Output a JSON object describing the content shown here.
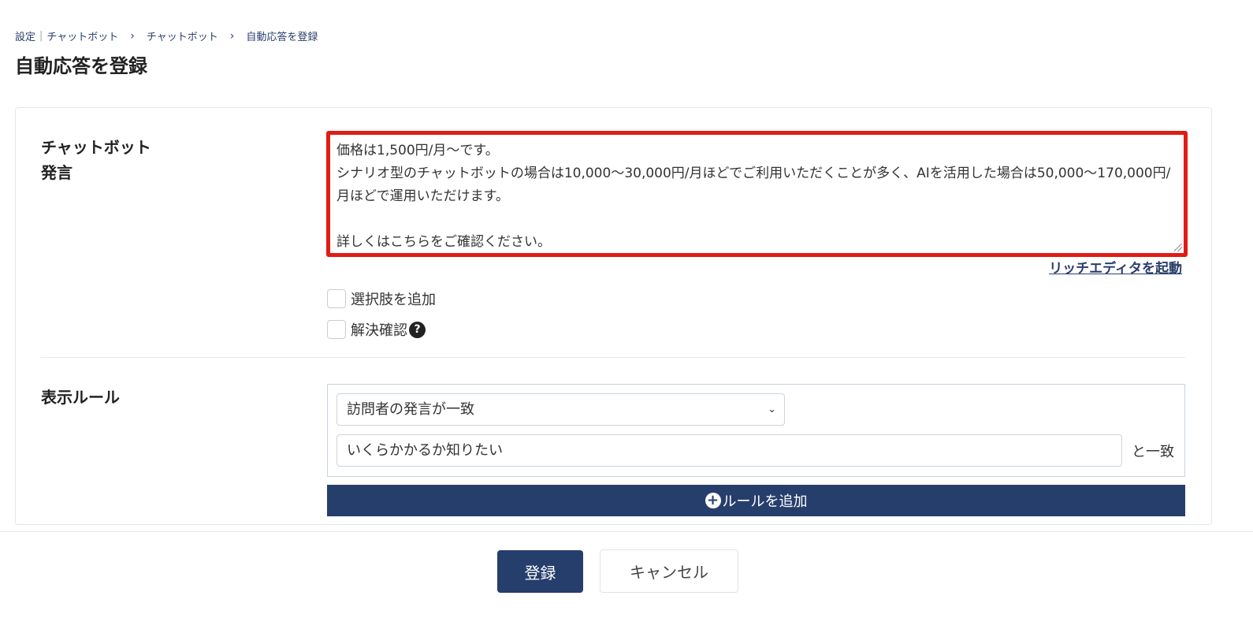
{
  "breadcrumb": {
    "root": "設定",
    "section": "チャットボット",
    "sub": "チャットボット",
    "current": "自動応答を登録"
  },
  "page_title": "自動応答を登録",
  "form": {
    "bot_label_line1": "チャットボット",
    "bot_label_line2": "発言",
    "bot_message": "価格は1,500円/月～です。\nシナリオ型のチャットボットの場合は10,000～30,000円/月ほどでご利用いただくことが多く、AIを活用した場合は50,000～170,000円/月ほどで運用いただけます。\n\n詳しくはこちらをご確認ください。",
    "rich_editor_link": "リッチエディタを起動",
    "add_choice_label": "選択肢を追加",
    "resolve_confirm_label": "解決確認",
    "help_icon_glyph": "?",
    "display_rule_label": "表示ルール",
    "rule_condition_selected": "訪問者の発言が一致",
    "rule_value": "いくらかかるか知りたい",
    "rule_match_suffix": "と一致",
    "add_rule_button": "ルールを追加"
  },
  "footer": {
    "register_button": "登録",
    "cancel_button": "キャンセル"
  },
  "icons": {
    "breadcrumb_chevron": "chevron-right-icon",
    "select_chevron": "chevron-down-icon",
    "help": "question-circle-icon",
    "plus": "plus-circle-icon"
  },
  "colors": {
    "primary": "#263e6c",
    "highlight_border": "#e01c14"
  }
}
